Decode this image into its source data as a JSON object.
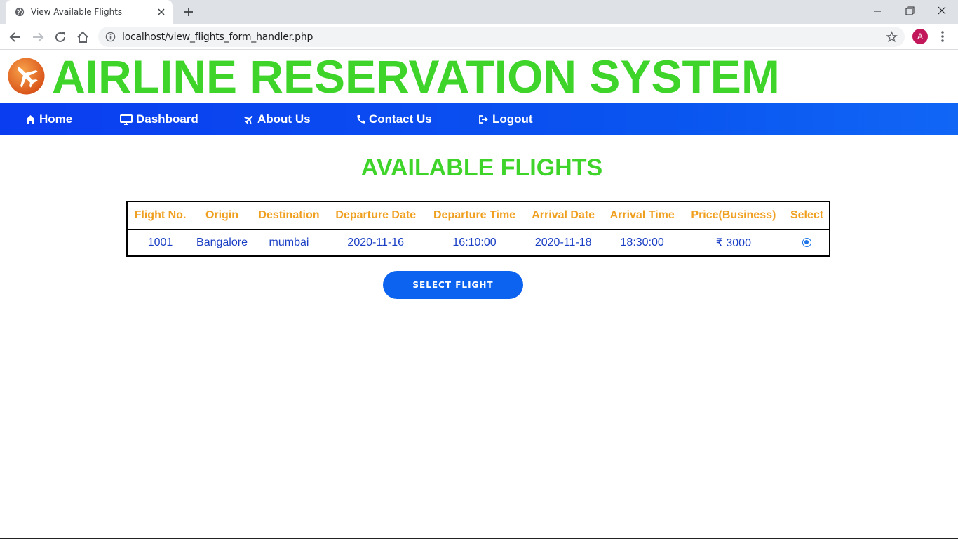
{
  "browser": {
    "tab_title": "View Available Flights",
    "url": "localhost/view_flights_form_handler.php",
    "avatar_letter": "A"
  },
  "site": {
    "title": "AIRLINE RESERVATION SYSTEM",
    "title_color": "#3ed42a"
  },
  "nav": {
    "home": "Home",
    "dashboard": "Dashboard",
    "about": "About Us",
    "contact": "Contact Us",
    "logout": "Logout"
  },
  "main": {
    "heading": "AVAILABLE FLIGHTS",
    "table": {
      "headers": [
        "Flight No.",
        "Origin",
        "Destination",
        "Departure Date",
        "Departure Time",
        "Arrival Date",
        "Arrival Time",
        "Price(Business)",
        "Select"
      ],
      "rows": [
        {
          "flight_no": "1001",
          "origin": "Bangalore",
          "destination": "mumbai",
          "departure_date": "2020-11-16",
          "departure_time": "16:10:00",
          "arrival_date": "2020-11-18",
          "arrival_time": "18:30:00",
          "price": "₹ 3000",
          "selected": true
        }
      ]
    },
    "select_button": "SELECT FLIGHT"
  },
  "colors": {
    "accent_green": "#3ed42a",
    "header_orange": "#f0a020",
    "cell_blue": "#1a3fc4",
    "nav_blue": "#0a48f0",
    "button_blue": "#0b63f0"
  }
}
